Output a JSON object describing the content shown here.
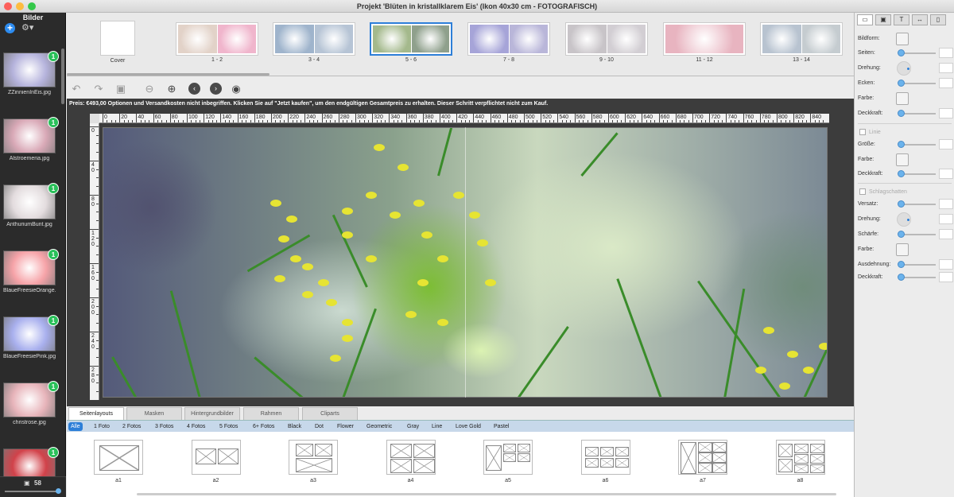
{
  "window": {
    "title": "Projekt 'Blüten in kristallklarem Eis' (Ikon 40x30 cm - FOTOGRAFISCH)"
  },
  "sidebar": {
    "title": "Bilder",
    "add_label": "+",
    "gear_label": "⚙▾",
    "items": [
      {
        "label": "ZZinnienInEis.jpg",
        "badge": "1",
        "color": "#b5b3dc"
      },
      {
        "label": "Alstroemeria.jpg",
        "badge": "1",
        "color": "#d9a9b7"
      },
      {
        "label": "AnthuriumBunt.jpg",
        "badge": "1",
        "color": "#e3dcde"
      },
      {
        "label": "BlaueFreesieOrange...",
        "badge": "1",
        "color": "#f6a3a8"
      },
      {
        "label": "BlaueFreesiePink.jpg",
        "badge": "1",
        "color": "#a9b0ee"
      },
      {
        "label": "christrose.jpg",
        "badge": "1",
        "color": "#e7b4ba"
      },
      {
        "label": "",
        "badge": "1",
        "color": "#d1424a"
      }
    ],
    "photo_count": "58"
  },
  "spreads": [
    {
      "label": "Cover",
      "colors": [
        "#ffffff"
      ]
    },
    {
      "label": "1 - 2",
      "colors": [
        "#e2d2c8",
        "#f0b5cc"
      ]
    },
    {
      "label": "3 - 4",
      "colors": [
        "#9fb4cc",
        "#b6c4d5"
      ]
    },
    {
      "label": "5 - 6",
      "colors": [
        "#a4b98c",
        "#8fa08c"
      ]
    },
    {
      "label": "7 - 8",
      "colors": [
        "#a6a4d8",
        "#b9b6d9"
      ]
    },
    {
      "label": "9 - 10",
      "colors": [
        "#c8c4c8",
        "#d2ced3"
      ]
    },
    {
      "label": "11 - 12",
      "colors": [
        "#e8b4c0"
      ]
    },
    {
      "label": "13 - 14",
      "colors": [
        "#b8c3d0",
        "#c5ccd0"
      ]
    }
  ],
  "price_bar": {
    "text": "Preis: €493,00     Optionen und Versandkosten nicht inbegriffen. Klicken Sie auf \"Jetzt kaufen\", um den endgültigen Gesamtpreis zu erhalten. Dieser Schritt verpflichtet nicht zum Kauf."
  },
  "ruler": {
    "h_labels": [
      "0",
      "20",
      "40",
      "60",
      "80",
      "100",
      "120",
      "140",
      "160",
      "180",
      "200",
      "220",
      "240",
      "260",
      "280",
      "300",
      "320",
      "340",
      "360",
      "380",
      "400",
      "420",
      "440",
      "460",
      "480",
      "500",
      "520",
      "540",
      "560",
      "580",
      "600",
      "620",
      "640",
      "660",
      "680",
      "700",
      "720",
      "740",
      "760",
      "780",
      "800",
      "820",
      "840"
    ],
    "v_labels": [
      "0",
      "40",
      "80",
      "120",
      "160",
      "200",
      "240",
      "280"
    ]
  },
  "tabs": [
    "Seitenlayouts",
    "Masken",
    "Hintergrundbilder",
    "Rahmen",
    "Cliparts"
  ],
  "categories": [
    "Alle",
    "1 Foto",
    "2 Fotos",
    "3 Fotos",
    "4 Fotos",
    "5 Fotos",
    "6+ Fotos",
    "Black",
    "Dot",
    "Flower",
    "Geometric",
    "Gray",
    "Line",
    "Love Gold",
    "Pastel"
  ],
  "layouts": [
    "a1",
    "a2",
    "a3",
    "a4",
    "a5",
    "a6",
    "a7",
    "a8"
  ],
  "right_panel": {
    "tabs": [
      "▭",
      "▣",
      "T",
      "↔",
      "▯"
    ],
    "rows": [
      "Bildform:",
      "Seiten:",
      "Drehung:",
      "Ecken:",
      "Farbe:",
      "Deckkraft:"
    ],
    "line_section": "Linie",
    "line_rows": [
      "Größe:",
      "Farbe:",
      "Deckkraft:"
    ],
    "shadow_section": "Schlagschatten",
    "shadow_rows": [
      "Versatz:",
      "Drehung:",
      "Schärfe:",
      "Farbe:",
      "Ausdehnung:",
      "Deckkraft:"
    ]
  }
}
